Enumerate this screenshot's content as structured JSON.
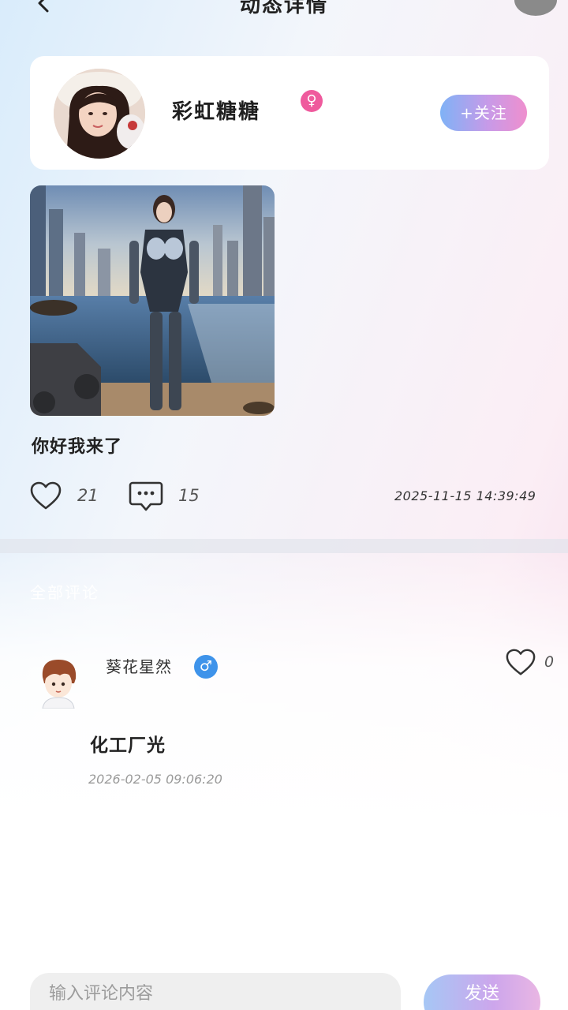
{
  "header": {
    "title": "动态详情"
  },
  "author": {
    "name": "彩虹糖糖",
    "gender_symbol": "♀",
    "follow_label": "+关注"
  },
  "post": {
    "text": "你好我来了",
    "likes": "21",
    "comments": "15",
    "time": "2025-11-15 14:39:49"
  },
  "comments_section": {
    "title": "全部评论",
    "items": [
      {
        "user": "葵花星然",
        "gender_symbol": "♂",
        "likes": "0",
        "text": "化工厂光",
        "time": "2026-02-05 09:06:20"
      }
    ]
  },
  "input": {
    "placeholder": "输入评论内容",
    "send_label": "发送"
  },
  "colors": {
    "accent_gradient_start": "#7fb2f6",
    "accent_gradient_end": "#ef8fce",
    "female_badge": "#ef5a9d",
    "male_badge": "#3e93ea"
  },
  "icons": [
    "back-arrow-icon",
    "heart-icon",
    "comment-bubble-icon"
  ]
}
